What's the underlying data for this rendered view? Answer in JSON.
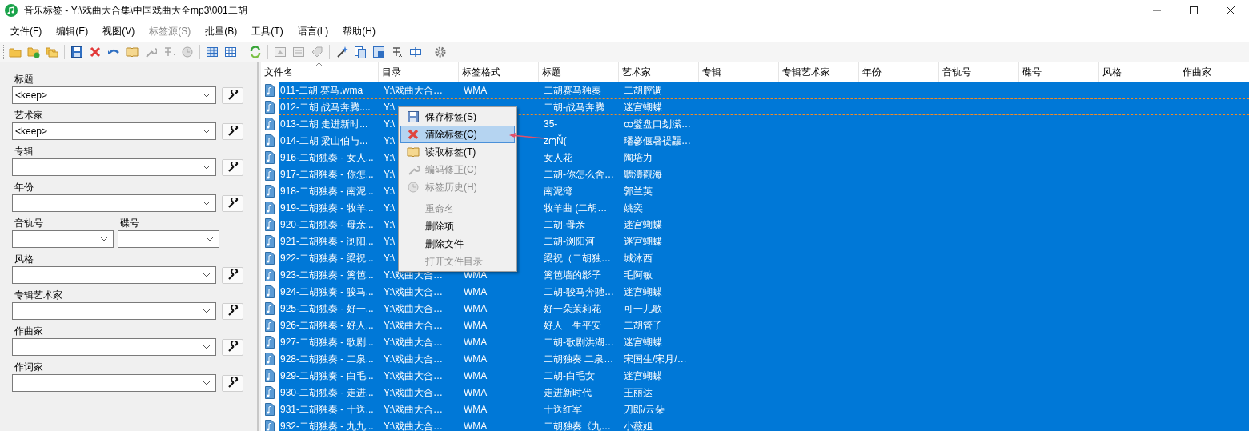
{
  "window": {
    "title": "音乐标签 - Y:\\戏曲大合集\\中国戏曲大全mp3\\001二胡"
  },
  "menu": [
    {
      "label": "文件(F)",
      "disabled": false
    },
    {
      "label": "编辑(E)",
      "disabled": false
    },
    {
      "label": "视图(V)",
      "disabled": false
    },
    {
      "label": "标签源(S)",
      "disabled": true
    },
    {
      "label": "批量(B)",
      "disabled": false
    },
    {
      "label": "工具(T)",
      "disabled": false
    },
    {
      "label": "语言(L)",
      "disabled": false
    },
    {
      "label": "帮助(H)",
      "disabled": false
    }
  ],
  "fields": [
    {
      "kind": "wide",
      "label": "标题",
      "value": "<keep>"
    },
    {
      "kind": "wide",
      "label": "艺术家",
      "value": "<keep>"
    },
    {
      "kind": "wide",
      "label": "专辑"
    },
    {
      "kind": "wide",
      "label": "年份"
    },
    {
      "kind": "half",
      "label": "音轨号"
    },
    {
      "kind": "half",
      "label": "碟号"
    },
    {
      "kind": "wide",
      "label": "风格"
    },
    {
      "kind": "wide",
      "label": "专辑艺术家"
    },
    {
      "kind": "wide",
      "label": "作曲家"
    },
    {
      "kind": "wide",
      "label": "作词家"
    }
  ],
  "table": {
    "columns": [
      "文件名",
      "目录",
      "标签格式",
      "标题",
      "艺术家",
      "专辑",
      "专辑艺术家",
      "年份",
      "音轨号",
      "碟号",
      "风格",
      "作曲家"
    ],
    "rows": [
      {
        "file": "011-二胡 赛马.wma",
        "dir": "Y:\\戏曲大合…",
        "format": "WMA",
        "title": "二胡赛马独奏",
        "artist": "二胡腔调",
        "selected": true,
        "focused": false
      },
      {
        "file": "012-二胡 战马奔腾....",
        "dir": "Y:\\",
        "title": "二胡-战马奔腾",
        "artist": "迷宫蝴蝶",
        "selected": true,
        "focused": true
      },
      {
        "file": "013-二胡 走进新时...",
        "dir": "Y:\\",
        "title": "35-",
        "artist": "ꝏ鐾盘口刬潆…",
        "selected": true,
        "focused": false
      },
      {
        "file": "014-二胡 梁山伯与...",
        "dir": "Y:\\",
        "title": "zɾๅŇ(",
        "artist": "璠嵾偃暑褆龘…",
        "selected": true,
        "focused": false
      },
      {
        "file": "916-二胡独奏 - 女人...",
        "dir": "Y:\\",
        "title": "女人花",
        "artist": "陶培力",
        "selected": true,
        "focused": false
      },
      {
        "file": "917-二胡独奏 - 你怎...",
        "dir": "Y:\\",
        "title": "二胡-你怎么舍…",
        "artist": "聽濤觀海",
        "selected": true,
        "focused": false
      },
      {
        "file": "918-二胡独奏 - 南泥...",
        "dir": "Y:\\",
        "title": "南泥湾",
        "artist": "郭兰英",
        "selected": true,
        "focused": false
      },
      {
        "file": "919-二胡独奏 - 牧羊...",
        "dir": "Y:\\",
        "title": "牧羊曲 (二胡…",
        "artist": "姚奕",
        "selected": true,
        "focused": false
      },
      {
        "file": "920-二胡独奏 - 母亲...",
        "dir": "Y:\\",
        "title": "二胡-母亲",
        "artist": "迷宫蝴蝶",
        "selected": true,
        "focused": false
      },
      {
        "file": "921-二胡独奏 - 浏阳...",
        "dir": "Y:\\",
        "title": "二胡-浏阳河",
        "artist": "迷宫蝴蝶",
        "selected": true,
        "focused": false
      },
      {
        "file": "922-二胡独奏 - 梁祝...",
        "dir": "Y:\\",
        "title": "梁祝（二胡独…",
        "artist": "城沐西",
        "selected": true,
        "focused": false
      },
      {
        "file": "923-二胡独奏 - 篱笆...",
        "dir": "Y:\\戏曲大合…",
        "format": "WMA",
        "title": "篱笆墙的影子",
        "artist": "毛阿敏",
        "selected": true,
        "focused": false
      },
      {
        "file": "924-二胡独奏 - 骏马...",
        "dir": "Y:\\戏曲大合…",
        "format": "WMA",
        "title": "二胡-骏马奔驰…",
        "artist": "迷宫蝴蝶",
        "selected": true,
        "focused": false
      },
      {
        "file": "925-二胡独奏 - 好一...",
        "dir": "Y:\\戏曲大合…",
        "format": "WMA",
        "title": "好一朵茉莉花",
        "artist": "可一儿歌",
        "selected": true,
        "focused": false
      },
      {
        "file": "926-二胡独奏 - 好人...",
        "dir": "Y:\\戏曲大合…",
        "format": "WMA",
        "title": "好人一生平安",
        "artist": "二胡管子",
        "selected": true,
        "focused": false
      },
      {
        "file": "927-二胡独奏 - 歌剧...",
        "dir": "Y:\\戏曲大合…",
        "format": "WMA",
        "title": "二胡-歌剧洪湖…",
        "artist": "迷宫蝴蝶",
        "selected": true,
        "focused": false
      },
      {
        "file": "928-二胡独奏 - 二泉...",
        "dir": "Y:\\戏曲大合…",
        "format": "WMA",
        "title": "二胡独奏 二泉…",
        "artist": "宋国生/宋月/…",
        "selected": true,
        "focused": false
      },
      {
        "file": "929-二胡独奏 - 白毛...",
        "dir": "Y:\\戏曲大合…",
        "format": "WMA",
        "title": "二胡-白毛女",
        "artist": "迷宫蝴蝶",
        "selected": true,
        "focused": false
      },
      {
        "file": "930-二胡独奏 - 走进...",
        "dir": "Y:\\戏曲大合…",
        "format": "WMA",
        "title": "走进新时代",
        "artist": "王丽达",
        "selected": true,
        "focused": false
      },
      {
        "file": "931-二胡独奏 - 十送...",
        "dir": "Y:\\戏曲大合…",
        "format": "WMA",
        "title": "十送红军",
        "artist": "刀郎/云朵",
        "selected": true,
        "focused": false
      },
      {
        "file": "932-二胡独奏 - 九九...",
        "dir": "Y:\\戏曲大合…",
        "format": "WMA",
        "title": "二胡独奏《九…",
        "artist": "小薇姐",
        "selected": true,
        "focused": false
      }
    ]
  },
  "context_menu": [
    {
      "kind": "item",
      "label": "保存标签(S)",
      "disabled": false,
      "selected": false
    },
    {
      "kind": "item",
      "label": "清除标签(C)",
      "disabled": false,
      "selected": true
    },
    {
      "kind": "item",
      "label": "读取标签(T)",
      "disabled": false,
      "selected": false
    },
    {
      "kind": "item",
      "label": "编码修正(C)",
      "disabled": true,
      "selected": false
    },
    {
      "kind": "item",
      "label": "标签历史(H)",
      "disabled": true,
      "selected": false
    },
    {
      "kind": "separator"
    },
    {
      "kind": "item",
      "label": "重命名",
      "disabled": true,
      "selected": false
    },
    {
      "kind": "item",
      "label": "删除项",
      "disabled": false,
      "selected": false
    },
    {
      "kind": "item",
      "label": "删除文件",
      "disabled": false,
      "selected": false
    },
    {
      "kind": "item",
      "label": "打开文件目录",
      "disabled": true,
      "selected": false
    }
  ]
}
